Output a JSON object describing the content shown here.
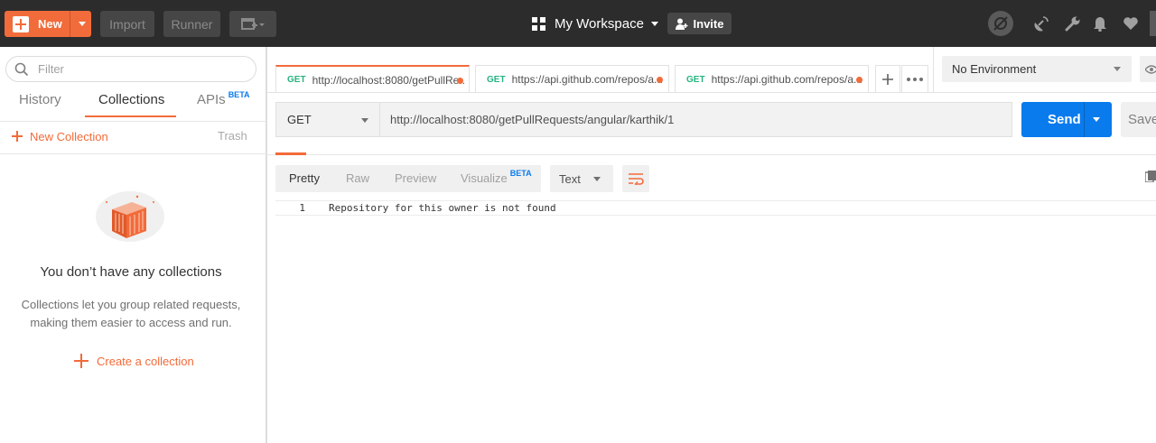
{
  "header": {
    "new_label": "New",
    "import_label": "Import",
    "runner_label": "Runner",
    "workspace_label": "My Workspace",
    "invite_label": "Invite"
  },
  "sidebar": {
    "filter_placeholder": "Filter",
    "tabs": [
      {
        "label": "History"
      },
      {
        "label": "Collections",
        "active": true
      },
      {
        "label": "APIs",
        "badge": "BETA"
      }
    ],
    "new_collection_label": "New Collection",
    "trash_label": "Trash",
    "empty_title": "You don’t have any collections",
    "empty_desc_line1": "Collections let you group related requests,",
    "empty_desc_line2": "making them easier to access and run.",
    "create_label": "Create a collection"
  },
  "request_tabs": [
    {
      "method": "GET",
      "url": "http://localhost:8080/getPullRe...",
      "active": true
    },
    {
      "method": "GET",
      "url": "https://api.github.com/repos/a..."
    },
    {
      "method": "GET",
      "url": "https://api.github.com/repos/a..."
    }
  ],
  "environment": {
    "selected": "No Environment"
  },
  "request": {
    "method": "GET",
    "url": "http://localhost:8080/getPullRequests/angular/karthik/1",
    "send_label": "Send",
    "save_label": "Save"
  },
  "response": {
    "formats": [
      {
        "label": "Pretty",
        "active": true
      },
      {
        "label": "Raw"
      },
      {
        "label": "Preview"
      },
      {
        "label": "Visualize",
        "badge": "BETA"
      }
    ],
    "text_type": "Text",
    "lines": [
      {
        "number": "1",
        "text": "Repository for this owner is not found"
      }
    ]
  },
  "colors": {
    "accent": "#f26b3a",
    "primary": "#097bed",
    "get_method": "#26b47f",
    "header_bg": "#2c2c2c"
  }
}
